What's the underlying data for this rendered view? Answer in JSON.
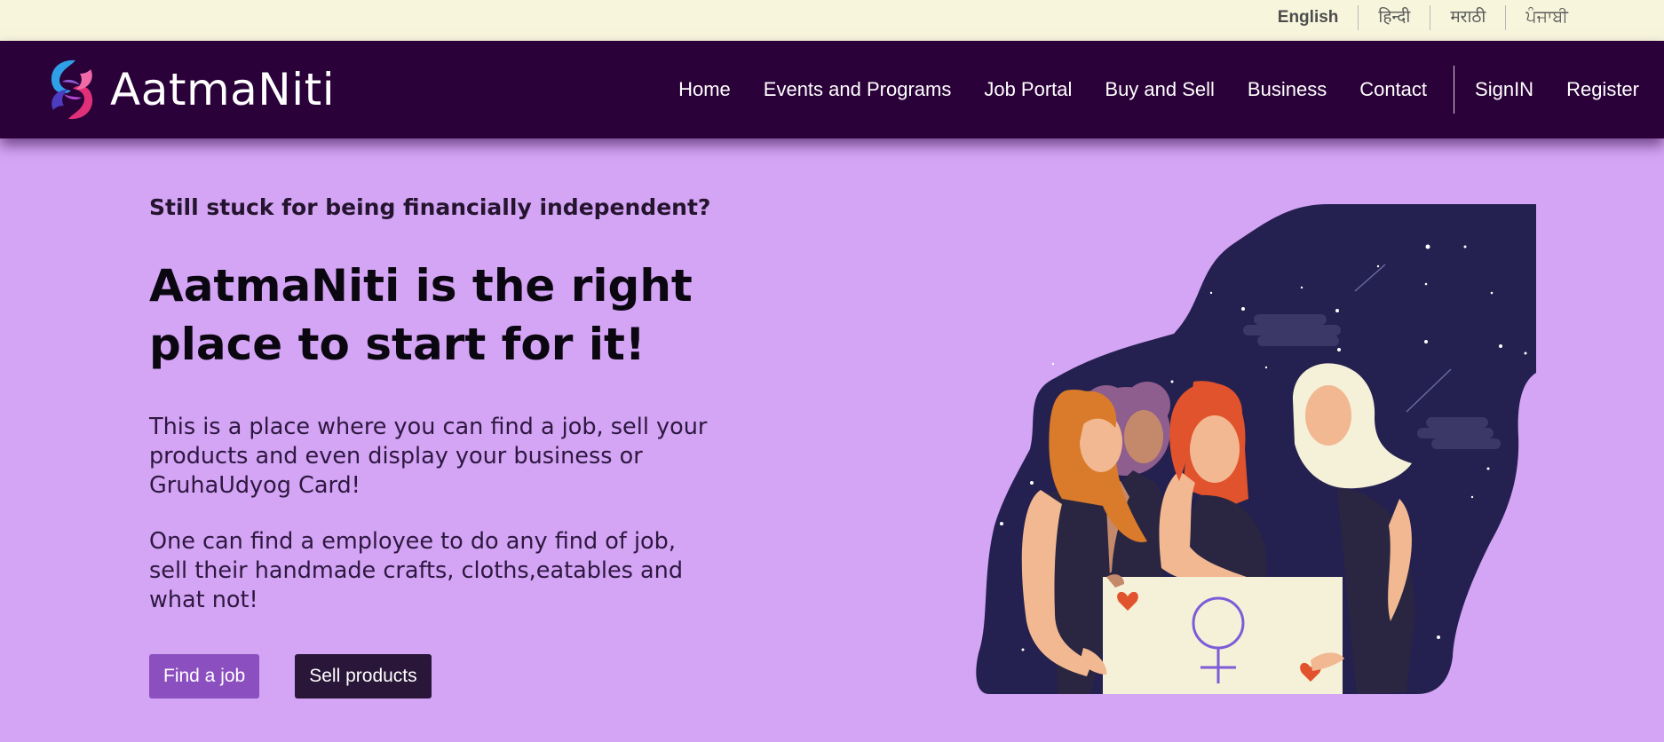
{
  "languages": [
    "English",
    "हिन्दी",
    "मराठी",
    "ਪੰਜਾਬੀ"
  ],
  "brand": {
    "name": "AatmaNiti"
  },
  "nav": {
    "items": [
      "Home",
      "Events and Programs",
      "Job Portal",
      "Buy and Sell",
      "Business",
      "Contact"
    ],
    "signin": "SignIN",
    "register": "Register"
  },
  "hero": {
    "tagline": "Still stuck for being financially independent?",
    "headline_line1": "AatmaNiti is the right",
    "headline_line2": "place to start for it!",
    "paragraph1": "This is a place where you can find a job, sell your products and even display your business or GruhaUdyog Card!",
    "paragraph2": "One can find a employee to do any find of job, sell their handmade crafts, cloths,eatables and what not!",
    "buttons": {
      "find_job": "Find a job",
      "sell_products": "Sell products"
    }
  },
  "colors": {
    "lang_bar": "#f7f6dd",
    "navbar": "#2a0138",
    "page_bg": "#d4a4f5",
    "primary_button": "#8b4fbf",
    "dark_button": "#2a1638",
    "night_sky": "#24204f"
  },
  "icons": {
    "brand": "swirl-logo-icon",
    "illustration": "women-empowerment-illustration"
  }
}
